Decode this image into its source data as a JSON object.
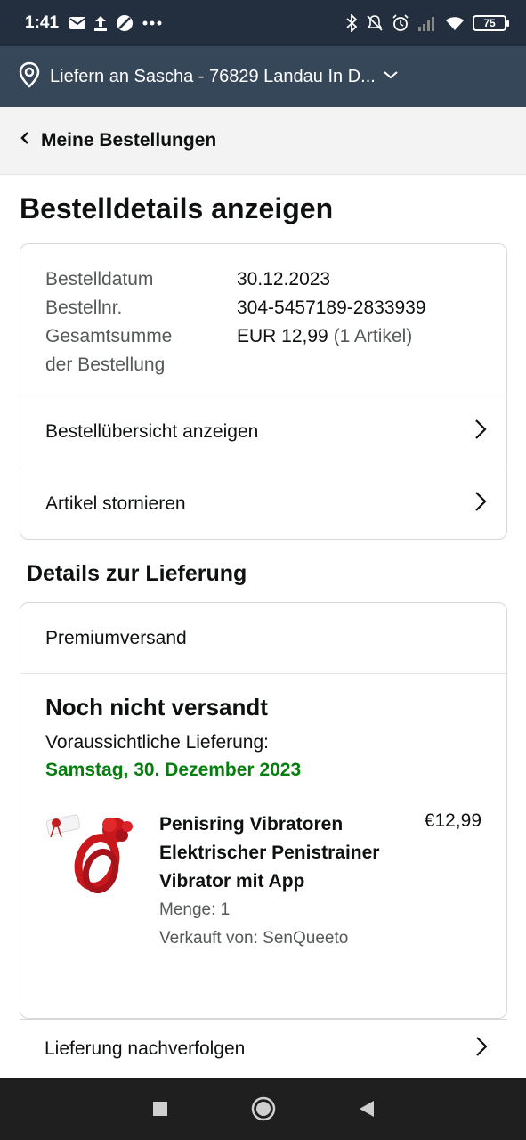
{
  "status_bar": {
    "time": "1:41",
    "battery": "75"
  },
  "location_bar": {
    "text": "Liefern an Sascha - 76829 Landau In D..."
  },
  "breadcrumb": {
    "label": "Meine Bestellungen"
  },
  "page": {
    "title": "Bestelldetails anzeigen"
  },
  "order_summary": {
    "date_label": "Bestelldatum",
    "date_value": "30.12.2023",
    "number_label": "Bestellnr.",
    "number_value": "304-5457189-2833939",
    "total_label_line1": "Gesamtsumme",
    "total_label_line2": "der Bestellung",
    "total_value": "EUR 12,99",
    "total_count": "(1 Artikel)"
  },
  "order_links": {
    "overview": "Bestellübersicht anzeigen",
    "cancel": "Artikel stornieren"
  },
  "delivery": {
    "section_title": "Details zur Lieferung",
    "ship_method": "Premiumversand",
    "status": "Noch nicht versandt",
    "expected_label": "Voraussichtliche Lieferung:",
    "expected_date": "Samstag, 30. Dezember 2023",
    "track_label": "Lieferung nachverfolgen"
  },
  "item": {
    "name": "Penisring Vibratoren Elektrischer Penistrainer Vibrator mit App",
    "quantity": "Menge: 1",
    "seller": "Verkauft von: SenQueeto",
    "price": "€12,99"
  },
  "colors": {
    "status_bar_bg": "#232f3e",
    "location_bar_bg": "#37475a",
    "delivery_date_green": "#067d0f"
  }
}
